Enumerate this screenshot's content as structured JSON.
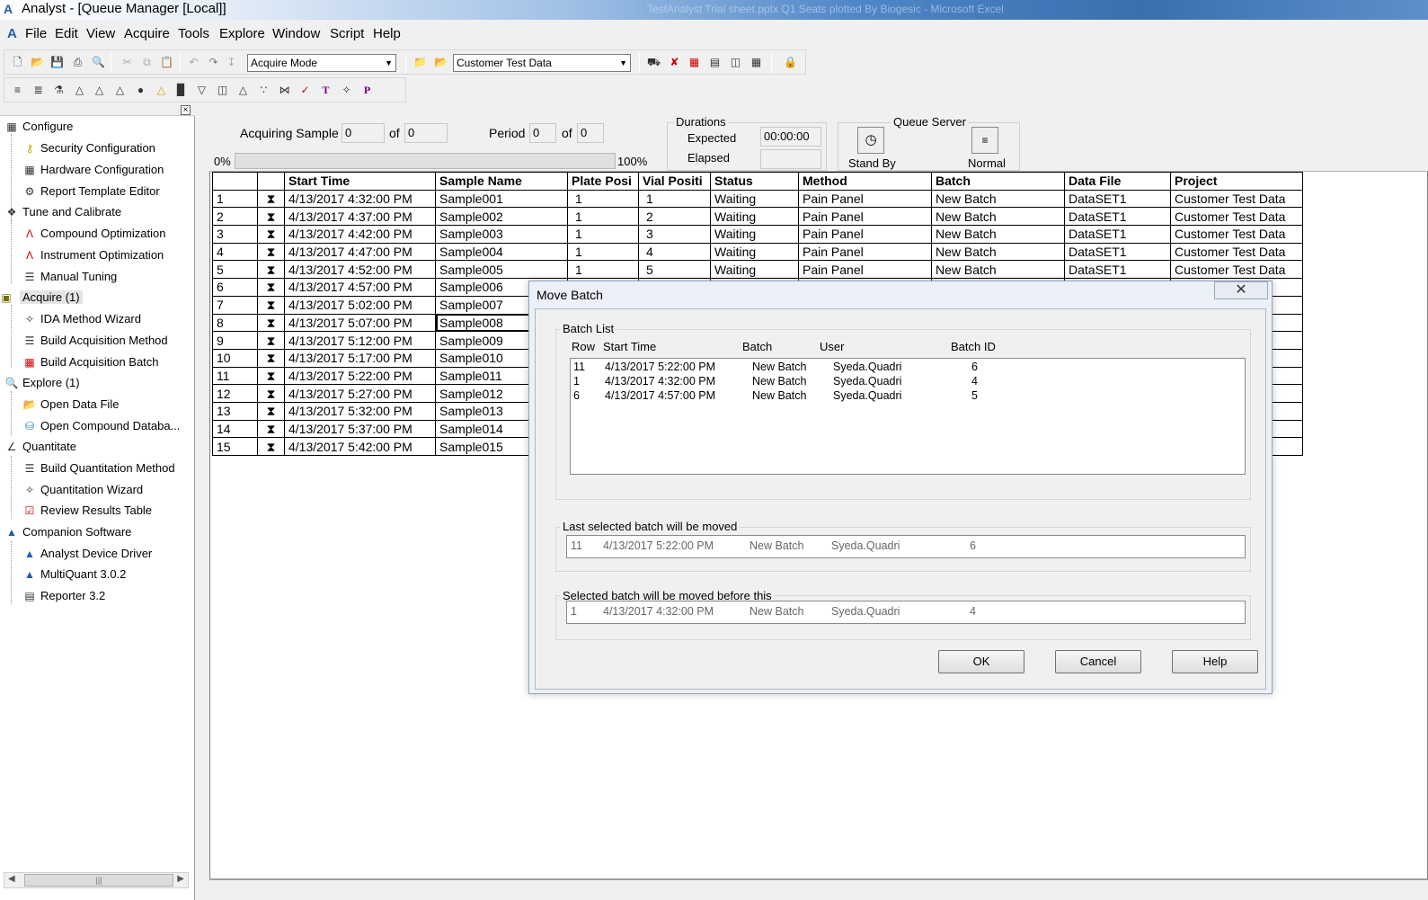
{
  "window": {
    "title": "Analyst - [Queue Manager [Local]]",
    "ghost_text": "TestAnalyst Trial sheet.pptx Q1 Seats plotted By Biogesic  -  Microsoft Excel"
  },
  "menu": [
    "File",
    "Edit",
    "View",
    "Acquire",
    "Tools",
    "Explore",
    "Window",
    "Script",
    "Help"
  ],
  "toolbar": {
    "mode_combo": "Acquire Mode",
    "project_combo": "Customer Test Data"
  },
  "nav": {
    "sections": [
      {
        "label": "Configure",
        "icon": "configure-icon",
        "items": [
          {
            "label": "Security Configuration",
            "icon": "key-icon"
          },
          {
            "label": "Hardware Configuration",
            "icon": "hardware-icon"
          },
          {
            "label": "Report Template Editor",
            "icon": "wrench-icon"
          }
        ]
      },
      {
        "label": "Tune and Calibrate",
        "icon": "tune-icon",
        "items": [
          {
            "label": "Compound Optimization",
            "icon": "compound-icon"
          },
          {
            "label": "Instrument Optimization",
            "icon": "instrument-icon"
          },
          {
            "label": "Manual Tuning",
            "icon": "manual-tuning-icon"
          }
        ]
      },
      {
        "label": "Acquire  (1)",
        "icon": "acquire-icon",
        "items": [
          {
            "label": "IDA Method Wizard",
            "icon": "wand-icon"
          },
          {
            "label": "Build Acquisition Method",
            "icon": "method-icon"
          },
          {
            "label": "Build Acquisition Batch",
            "icon": "batch-icon"
          }
        ]
      },
      {
        "label": "Explore  (1)",
        "icon": "explore-icon",
        "items": [
          {
            "label": "Open Data File",
            "icon": "folder-icon"
          },
          {
            "label": "Open Compound Databa...",
            "icon": "database-icon"
          }
        ]
      },
      {
        "label": "Quantitate",
        "icon": "quantitate-icon",
        "items": [
          {
            "label": "Build Quantitation Method",
            "icon": "quant-method-icon"
          },
          {
            "label": "Quantitation Wizard",
            "icon": "wand-icon"
          },
          {
            "label": "Review Results Table",
            "icon": "results-icon"
          }
        ]
      },
      {
        "label": "Companion Software",
        "icon": "companion-icon",
        "items": [
          {
            "label": "Analyst Device Driver",
            "icon": "driver-icon"
          },
          {
            "label": "MultiQuant 3.0.2",
            "icon": "multiquant-icon"
          },
          {
            "label": "Reporter 3.2",
            "icon": "reporter-icon"
          }
        ]
      }
    ]
  },
  "status": {
    "acquiring_label": "Acquiring Sample",
    "acq_value": "0",
    "of_label": "of",
    "acq_total": "0",
    "period_label": "Period",
    "period_value": "0",
    "period_total": "0",
    "progress_min": "0%",
    "progress_max": "100%",
    "progress": 0,
    "durations_label": "Durations",
    "expected_label": "Expected",
    "expected_value": "00:00:00",
    "elapsed_label": "Elapsed",
    "elapsed_value": "",
    "queue_server_label": "Queue Server",
    "standby_label": "Stand By",
    "normal_label": "Normal"
  },
  "grid": {
    "headers": [
      "",
      "",
      "Start Time",
      "Sample Name",
      "Plate Posi",
      "Vial Positi",
      "Status",
      "Method",
      "Batch",
      "Data File",
      "Project"
    ],
    "rows": [
      [
        "1",
        "4/13/2017 4:32:00 PM",
        "Sample001",
        "1",
        "1",
        "Waiting",
        "Pain Panel",
        "New Batch",
        "DataSET1",
        "Customer Test Data"
      ],
      [
        "2",
        "4/13/2017 4:37:00 PM",
        "Sample002",
        "1",
        "2",
        "Waiting",
        "Pain Panel",
        "New Batch",
        "DataSET1",
        "Customer Test Data"
      ],
      [
        "3",
        "4/13/2017 4:42:00 PM",
        "Sample003",
        "1",
        "3",
        "Waiting",
        "Pain Panel",
        "New Batch",
        "DataSET1",
        "Customer Test Data"
      ],
      [
        "4",
        "4/13/2017 4:47:00 PM",
        "Sample004",
        "1",
        "4",
        "Waiting",
        "Pain Panel",
        "New Batch",
        "DataSET1",
        "Customer Test Data"
      ],
      [
        "5",
        "4/13/2017 4:52:00 PM",
        "Sample005",
        "1",
        "5",
        "Waiting",
        "Pain Panel",
        "New Batch",
        "DataSET1",
        "Customer Test Data"
      ],
      [
        "6",
        "4/13/2017 4:57:00 PM",
        "Sample006",
        "",
        "",
        "",
        "",
        "",
        "",
        "ata"
      ],
      [
        "7",
        "4/13/2017 5:02:00 PM",
        "Sample007",
        "",
        "",
        "",
        "",
        "",
        "",
        "ata"
      ],
      [
        "8",
        "4/13/2017 5:07:00 PM",
        "Sample008",
        "",
        "",
        "",
        "",
        "",
        "",
        "ata"
      ],
      [
        "9",
        "4/13/2017 5:12:00 PM",
        "Sample009",
        "",
        "",
        "",
        "",
        "",
        "",
        "ata"
      ],
      [
        "10",
        "4/13/2017 5:17:00 PM",
        "Sample010",
        "",
        "",
        "",
        "",
        "",
        "",
        "ata"
      ],
      [
        "11",
        "4/13/2017 5:22:00 PM",
        "Sample011",
        "",
        "",
        "",
        "",
        "",
        "",
        "ata"
      ],
      [
        "12",
        "4/13/2017 5:27:00 PM",
        "Sample012",
        "",
        "",
        "",
        "",
        "",
        "",
        "ata"
      ],
      [
        "13",
        "4/13/2017 5:32:00 PM",
        "Sample013",
        "",
        "",
        "",
        "",
        "",
        "",
        "ata"
      ],
      [
        "14",
        "4/13/2017 5:37:00 PM",
        "Sample014",
        "",
        "",
        "",
        "",
        "",
        "",
        "ata"
      ],
      [
        "15",
        "4/13/2017 5:42:00 PM",
        "Sample015",
        "",
        "",
        "",
        "",
        "",
        "",
        "ata"
      ]
    ]
  },
  "dialog": {
    "title": "Move Batch",
    "batch_list_label": "Batch List",
    "columns": [
      "Row",
      "Start Time",
      "Batch",
      "User",
      "Batch ID"
    ],
    "batches": [
      [
        "11",
        "4/13/2017 5:22:00 PM",
        "New Batch",
        "Syeda.Quadri",
        "6"
      ],
      [
        "1",
        "4/13/2017 4:32:00 PM",
        "New Batch",
        "Syeda.Quadri",
        "4"
      ],
      [
        "6",
        "4/13/2017 4:57:00 PM",
        "New Batch",
        "Syeda.Quadri",
        "5"
      ]
    ],
    "last_selected_label": "Last selected batch will be moved",
    "last_selected": [
      "11",
      "4/13/2017 5:22:00 PM",
      "New Batch",
      "Syeda.Quadri",
      "6"
    ],
    "before_label": "Selected batch will be moved before this",
    "before": [
      "1",
      "4/13/2017 4:32:00 PM",
      "New Batch",
      "Syeda.Quadri",
      "4"
    ],
    "ok_label": "OK",
    "cancel_label": "Cancel",
    "help_label": "Help",
    "close_glyph": "✕"
  }
}
